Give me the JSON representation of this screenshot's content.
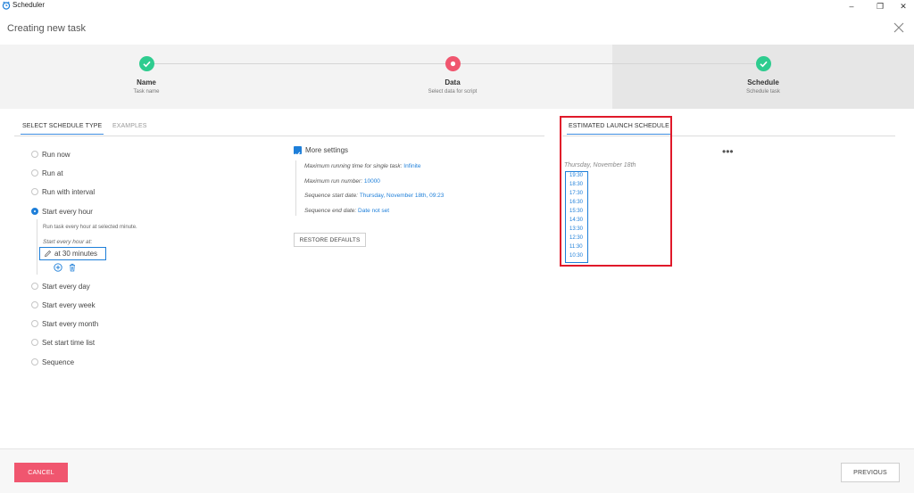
{
  "window": {
    "app_title": "Scheduler",
    "minimize": "–",
    "maximize": "❐",
    "close": "✕"
  },
  "header": {
    "title": "Creating new task"
  },
  "steps": [
    {
      "name": "Name",
      "desc": "Task name",
      "state": "done"
    },
    {
      "name": "Data",
      "desc": "Select data for script",
      "state": "current"
    },
    {
      "name": "Schedule",
      "desc": "Schedule task",
      "state": "done"
    }
  ],
  "colors": {
    "accent": "#1e7fd9",
    "done": "#2ecc8f",
    "current": "#f0566f",
    "highlight_red": "#e0192a"
  },
  "left_tabs": [
    {
      "label": "SELECT SCHEDULE TYPE",
      "active": true
    },
    {
      "label": "EXAMPLES",
      "active": false
    }
  ],
  "schedule_types": [
    {
      "label": "Run now",
      "checked": false
    },
    {
      "label": "Run at",
      "checked": false
    },
    {
      "label": "Run with interval",
      "checked": false
    },
    {
      "label": "Start every hour",
      "checked": true
    },
    {
      "label": "Start every day",
      "checked": false
    },
    {
      "label": "Start every week",
      "checked": false
    },
    {
      "label": "Start every month",
      "checked": false
    },
    {
      "label": "Set start time list",
      "checked": false
    },
    {
      "label": "Sequence",
      "checked": false
    }
  ],
  "hourly": {
    "hint": "Run task every hour at selected minute.",
    "field_label": "Start every hour at:",
    "value": "at 30 minutes",
    "edit_icon": "pencil-icon",
    "add_icon": "plus-circle-icon",
    "delete_icon": "trash-icon"
  },
  "more_settings": {
    "label": "More settings",
    "checked": true,
    "items": [
      {
        "label": "Maximum running time for single task:",
        "value": "Infinite"
      },
      {
        "label": "Maximum run number:",
        "value": "10000"
      },
      {
        "label": "Sequence start date:",
        "value": "Thursday, November 18th, 09:23"
      },
      {
        "label": "Sequence end date:",
        "value": "Date not set"
      }
    ],
    "restore_label": "RESTORE DEFAULTS"
  },
  "estimated": {
    "tab_label": "ESTIMATED LAUNCH SCHEDULE",
    "menu": "•••",
    "date": "Thursday, November 18th",
    "times": [
      "19:30",
      "18:30",
      "17:30",
      "16:30",
      "15:30",
      "14:30",
      "13:30",
      "12:30",
      "11:30",
      "10:30"
    ]
  },
  "footer": {
    "cancel_label": "CANCEL",
    "previous_label": "PREVIOUS"
  }
}
